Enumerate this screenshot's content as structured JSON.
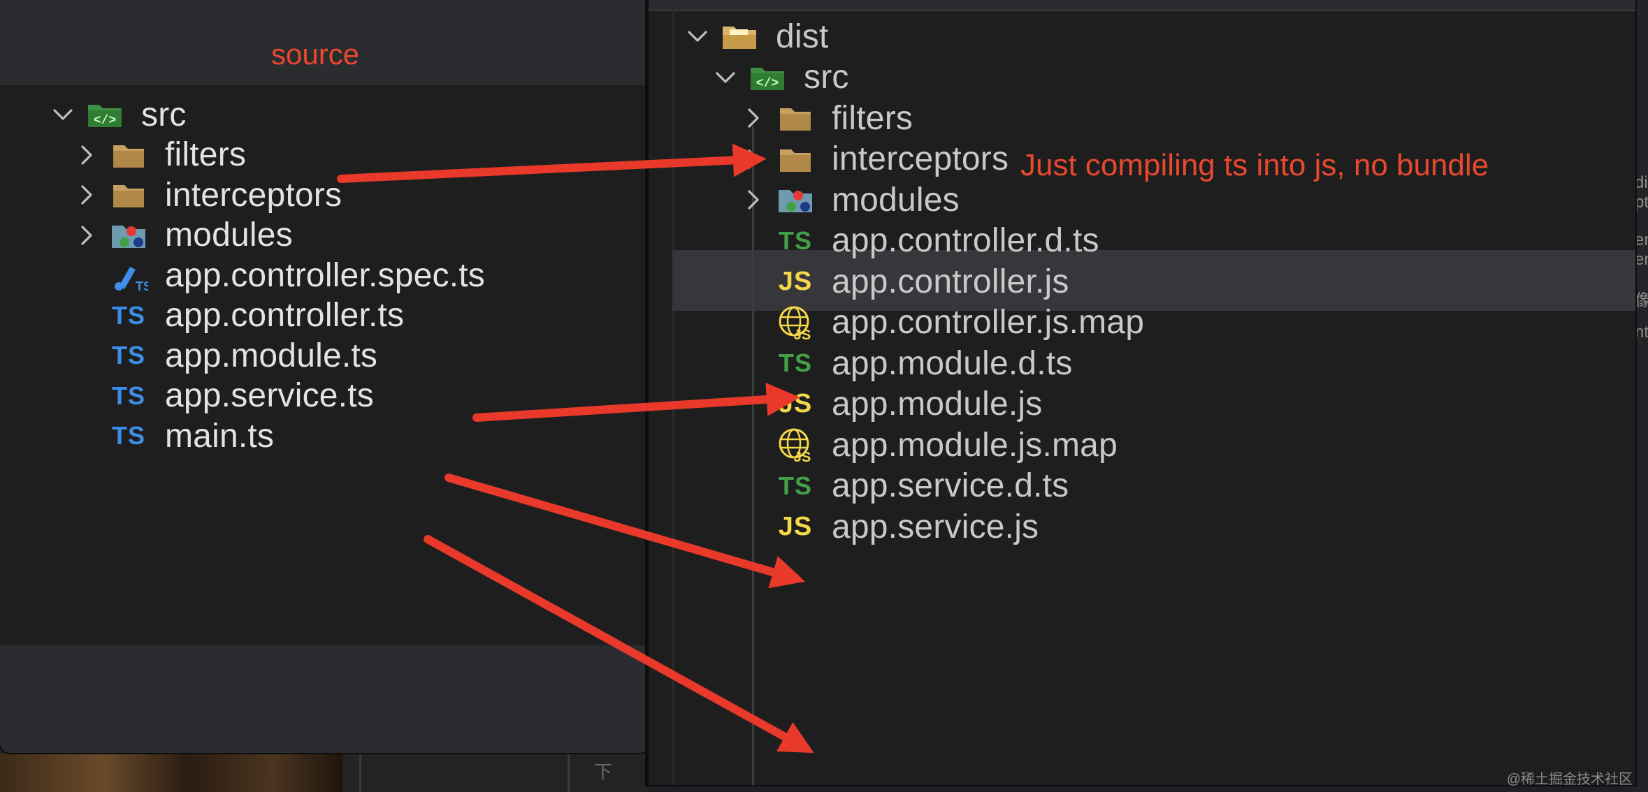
{
  "left": {
    "title": "source",
    "items": [
      {
        "label": "src",
        "type": "folder-src",
        "chevron": "open",
        "depth": 0
      },
      {
        "label": "filters",
        "type": "folder",
        "chevron": "closed",
        "depth": 1
      },
      {
        "label": "interceptors",
        "type": "folder",
        "chevron": "closed",
        "depth": 1
      },
      {
        "label": "modules",
        "type": "folder-modules",
        "chevron": "closed",
        "depth": 1
      },
      {
        "label": "app.controller.spec.ts",
        "type": "spec",
        "chevron": "none",
        "depth": 1
      },
      {
        "label": "app.controller.ts",
        "type": "ts",
        "chevron": "none",
        "depth": 1
      },
      {
        "label": "app.module.ts",
        "type": "ts",
        "chevron": "none",
        "depth": 1
      },
      {
        "label": "app.service.ts",
        "type": "ts",
        "chevron": "none",
        "depth": 1
      },
      {
        "label": "main.ts",
        "type": "ts",
        "chevron": "none",
        "depth": 1
      }
    ]
  },
  "right": {
    "items": [
      {
        "label": "dist",
        "type": "folder-dist",
        "chevron": "open",
        "depth": 0
      },
      {
        "label": "src",
        "type": "folder-src",
        "chevron": "open",
        "depth": 1
      },
      {
        "label": "filters",
        "type": "folder",
        "chevron": "closed",
        "depth": 2
      },
      {
        "label": "interceptors",
        "type": "folder",
        "chevron": "closed",
        "depth": 2
      },
      {
        "label": "modules",
        "type": "folder-modules",
        "chevron": "closed",
        "depth": 2,
        "selected": true
      },
      {
        "label": "app.controller.d.ts",
        "type": "dts",
        "chevron": "none",
        "depth": 2
      },
      {
        "label": "app.controller.js",
        "type": "js",
        "chevron": "none",
        "depth": 2
      },
      {
        "label": "app.controller.js.map",
        "type": "jsmap",
        "chevron": "none",
        "depth": 2
      },
      {
        "label": "app.module.d.ts",
        "type": "dts",
        "chevron": "none",
        "depth": 2
      },
      {
        "label": "app.module.js",
        "type": "js",
        "chevron": "none",
        "depth": 2
      },
      {
        "label": "app.module.js.map",
        "type": "jsmap",
        "chevron": "none",
        "depth": 2
      },
      {
        "label": "app.service.d.ts",
        "type": "dts",
        "chevron": "none",
        "depth": 2
      },
      {
        "label": "app.service.js",
        "type": "js",
        "chevron": "none",
        "depth": 2
      }
    ]
  },
  "badges": {
    "ts": "TS",
    "js": "JS"
  },
  "annotation": "Just compiling ts into js, no bundle",
  "watermark": "@稀土掘金技术社区",
  "background": {
    "right_fragments": [
      "dia",
      "pti",
      "en",
      "en",
      "像",
      "nt"
    ],
    "bottom_hint": "下"
  },
  "colors": {
    "accent_red": "#e8492e",
    "ts_blue": "#3c8ee8",
    "ts_green": "#43a047",
    "js_yellow": "#f3d84a",
    "folder": "#c8a060"
  }
}
